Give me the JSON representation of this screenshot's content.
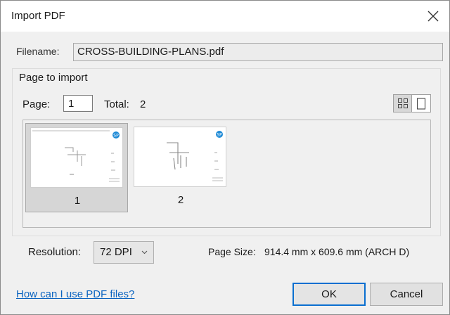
{
  "dialog": {
    "title": "Import PDF",
    "filename_label": "Filename:",
    "filename_value": "CROSS-BUILDING-PLANS.pdf",
    "group_title": "Page to import",
    "page_label": "Page:",
    "page_value": "1",
    "total_label": "Total:",
    "total_value": "2",
    "view_modes": [
      "grid-view-icon",
      "single-page-view-icon"
    ],
    "thumbnails": [
      {
        "label": "1",
        "selected": true
      },
      {
        "label": "2",
        "selected": false
      }
    ],
    "resolution_label": "Resolution:",
    "resolution_value": "72 DPI",
    "page_size_label": "Page Size:",
    "page_size_value": "914.4 mm x 609.6 mm (ARCH D)",
    "help_link": "How can I use PDF files?",
    "ok_label": "OK",
    "cancel_label": "Cancel",
    "badge_text": "SP",
    "colors": {
      "link": "#0b64c0",
      "ok_border": "#0a6fd0",
      "badge": "#1e8ad6"
    }
  }
}
